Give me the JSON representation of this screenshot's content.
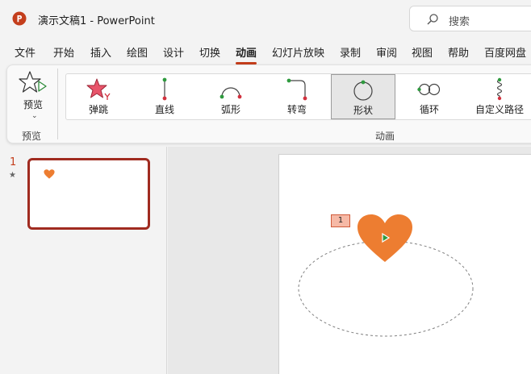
{
  "window": {
    "title": "演示文稿1  -  PowerPoint",
    "search_placeholder": "搜索"
  },
  "menu": {
    "tabs": [
      "文件",
      "开始",
      "插入",
      "绘图",
      "设计",
      "切换",
      "动画",
      "幻灯片放映",
      "录制",
      "审阅",
      "视图",
      "帮助",
      "百度网盘"
    ],
    "active_tab": "动画"
  },
  "ribbon": {
    "preview_button": "预览",
    "preview_group": "预览",
    "animation_group": "动画",
    "gallery": [
      {
        "label": "弹跳",
        "icon": "bounce-star-icon"
      },
      {
        "label": "直线",
        "icon": "line-path-icon"
      },
      {
        "label": "弧形",
        "icon": "arc-path-icon"
      },
      {
        "label": "转弯",
        "icon": "turn-path-icon"
      },
      {
        "label": "形状",
        "icon": "shape-path-icon",
        "selected": true
      },
      {
        "label": "循环",
        "icon": "loop-path-icon"
      },
      {
        "label": "自定义路径",
        "icon": "custom-path-icon"
      }
    ]
  },
  "thumbnails": {
    "slide_number": "1",
    "transition_marker": "★"
  },
  "slide": {
    "animation_tag": "1",
    "shape": "heart",
    "shape_color": "#ed7d31"
  },
  "colors": {
    "accent": "#c43e1c",
    "heart": "#ed7d31",
    "thumb_border": "#a02b20"
  }
}
